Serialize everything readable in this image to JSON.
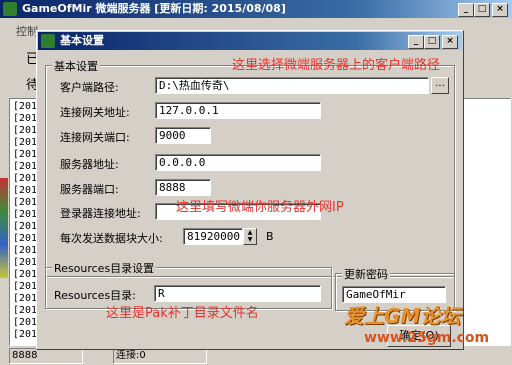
{
  "main_window": {
    "title": "GameOfMir 微端服务器 [更新日期: 2015/08/08]",
    "menu_partial": "控制",
    "side_char_1": "已",
    "side_char_2": "待",
    "log_prefix": "[201",
    "log_lines": 20,
    "status_left": "8888",
    "status_mid": "连接:0",
    "colors": {
      "titlebar": "#0a246a",
      "titlebar_end": "#a6caf0"
    }
  },
  "dialog": {
    "title": "基本设置",
    "controls": {
      "minimize": "_",
      "maximize": "□",
      "close": "×"
    },
    "basic_group": {
      "legend": "基本设置",
      "client_path_label": "客户端路径:",
      "client_path_value": "D:\\热血传奇\\",
      "browse_label": "...",
      "gateway_addr_label": "连接网关地址:",
      "gateway_addr_value": "127.0.0.1",
      "gateway_port_label": "连接网关端口:",
      "gateway_port_value": "9000",
      "server_addr_label": "服务器地址:",
      "server_addr_value": "0.0.0.0",
      "server_port_label": "服务器端口:",
      "server_port_value": "8888",
      "login_addr_label": "登录器连接地址:",
      "login_addr_value": "",
      "block_size_label": "每次发送数据块大小:",
      "block_size_value": "81920000",
      "block_size_unit": "B"
    },
    "resources_group": {
      "legend": "Resources目录设置",
      "dir_label": "Resources目录:",
      "dir_value": "R"
    },
    "password_group": {
      "legend": "更新密码",
      "value": "GameOfMir"
    },
    "ok_button": "确定(O)"
  },
  "annotations": {
    "client_path": "这里选择微端服务器上的客户端路径",
    "login_addr": "这里填写微端你服务器外网IP",
    "resources": "这里是Pak补丁目录文件名"
  },
  "watermark": {
    "line1": "爱上GM论坛",
    "line2": "www.25gm.com"
  }
}
